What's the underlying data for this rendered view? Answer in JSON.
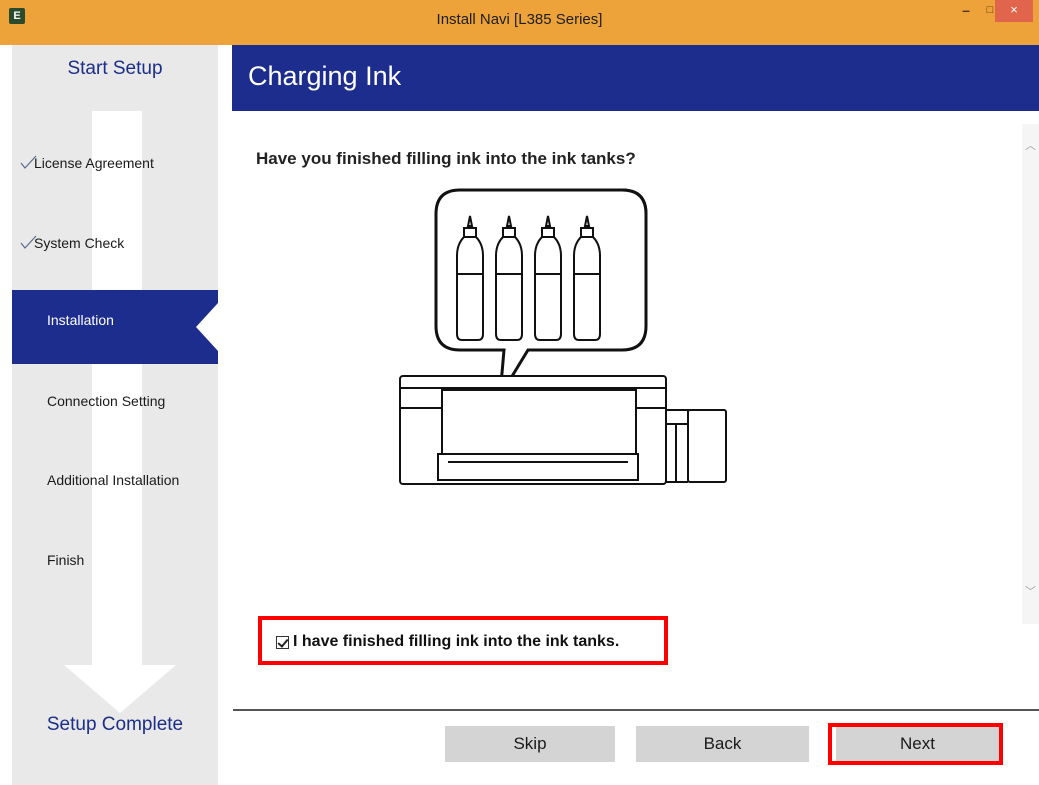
{
  "window": {
    "title": "Install Navi [L385 Series]",
    "app_icon_letter": "E",
    "minimize": "–",
    "maximize": "□",
    "close": "×",
    "accent_color": "#eda33a"
  },
  "sidebar": {
    "start_label": "Start Setup",
    "end_label": "Setup Complete",
    "steps": [
      {
        "label": "License Agreement",
        "status": "done"
      },
      {
        "label": "System Check",
        "status": "done"
      },
      {
        "label": "Installation",
        "status": "active"
      },
      {
        "label": "Connection Setting",
        "status": "pending"
      },
      {
        "label": "Additional Installation",
        "status": "pending"
      },
      {
        "label": "Finish",
        "status": "pending"
      }
    ],
    "active_color": "#1c2d8e"
  },
  "header": {
    "title": "Charging Ink"
  },
  "content": {
    "question": "Have you finished filling ink into the ink tanks?",
    "confirm_checkbox": {
      "label": "I have finished filling ink into the ink tanks.",
      "checked": true
    }
  },
  "buttons": {
    "skip": "Skip",
    "back": "Back",
    "next": "Next"
  }
}
